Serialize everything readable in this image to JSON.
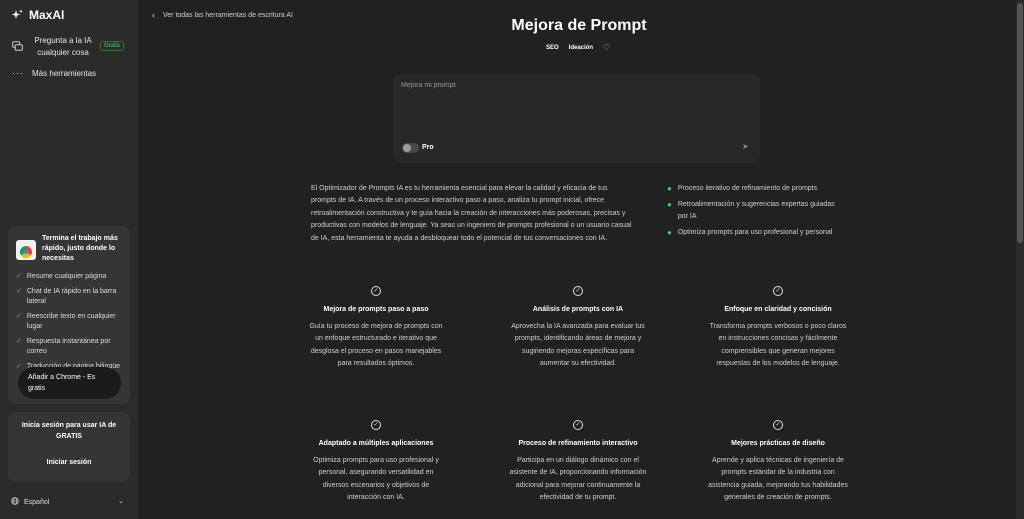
{
  "sidebar": {
    "brand": "MaxAI",
    "ask_label": "Pregunta a la IA cualquier cosa",
    "ask_badge": "Gratis",
    "more_label": "Más herramientas",
    "promo": {
      "title": "Termina el trabajo más rápido, justo donde lo necesitas",
      "features": [
        "Resume cualquier página",
        "Chat de IA rápido en la barra lateral",
        "Reescribe texto en cualquier lugar",
        "Respuesta instantánea por correo",
        "Traducción de página bilingüe"
      ],
      "cta": "Añadir a Chrome - Es gratis"
    },
    "signin": {
      "text": "Inicia sesión para usar IA de GRATIS",
      "button": "Iniciar sesión"
    },
    "language": "Español"
  },
  "main": {
    "back_link": "Ver todas las herramientas de escritura AI",
    "title": "Mejora de Prompt",
    "tags": [
      "SEO",
      "Ideación"
    ],
    "prompt_placeholder": "Mejora mi prompt",
    "pro_label": "Pro",
    "description": "El Optimizador de Prompts IA es tu herramienta esencial para elevar la calidad y eficacia de tus prompts de IA. A través de un proceso interactivo paso a paso, analiza tu prompt inicial, ofrece retroalimentación constructiva y te guía hacia la creación de interacciones más poderosas, precisas y productivas con modelos de lenguaje. Ya seas un ingeniero de prompts profesional o un usuario casual de IA, esta herramienta te ayuda a desbloquear todo el potencial de tus conversaciones con IA.",
    "bullets": [
      "Proceso iterativo de refinamiento de prompts",
      "Retroalimentación y sugerencias expertas guiadas por IA",
      "Optimiza prompts para uso profesional y personal"
    ],
    "cards": [
      {
        "title": "Mejora de prompts paso a paso",
        "text": "Guía tu proceso de mejora de prompts con un enfoque estructurado e iterativo que desglosa el proceso en pasos manejables para resultados óptimos."
      },
      {
        "title": "Análisis de prompts con IA",
        "text": "Aprovecha la IA avanzada para evaluar tus prompts, identificando áreas de mejora y sugiriendo mejoras específicas para aumentar su efectividad."
      },
      {
        "title": "Enfoque en claridad y concisión",
        "text": "Transforma prompts verbosos o poco claros en instrucciones concisas y fácilmente comprensibles que generan mejores respuestas de los modelos de lenguaje."
      },
      {
        "title": "Adaptado a múltiples aplicaciones",
        "text": "Optimiza prompts para uso profesional y personal, asegurando versatilidad en diversos escenarios y objetivos de interacción con IA."
      },
      {
        "title": "Proceso de refinamiento interactivo",
        "text": "Participa en un diálogo dinámico con el asistente de IA, proporcionando información adicional para mejorar continuamente la efectividad de tu prompt."
      },
      {
        "title": "Mejores prácticas de diseño",
        "text": "Aprende y aplica técnicas de ingeniería de prompts estándar de la industria con asistencia guiada, mejorando tus habilidades generales de creación de prompts."
      }
    ]
  },
  "colors": {
    "background": "#212121",
    "sidebar": "#2b2b2b",
    "accent_green": "#4cc26b"
  },
  "icons": {
    "brand": "sparkle-icon",
    "ask": "chat-icon",
    "more": "more-dots-icon",
    "back": "chevron-left-icon",
    "favorite": "heart-icon",
    "send": "send-icon",
    "check": "check-circle-icon",
    "language": "globe-icon"
  }
}
